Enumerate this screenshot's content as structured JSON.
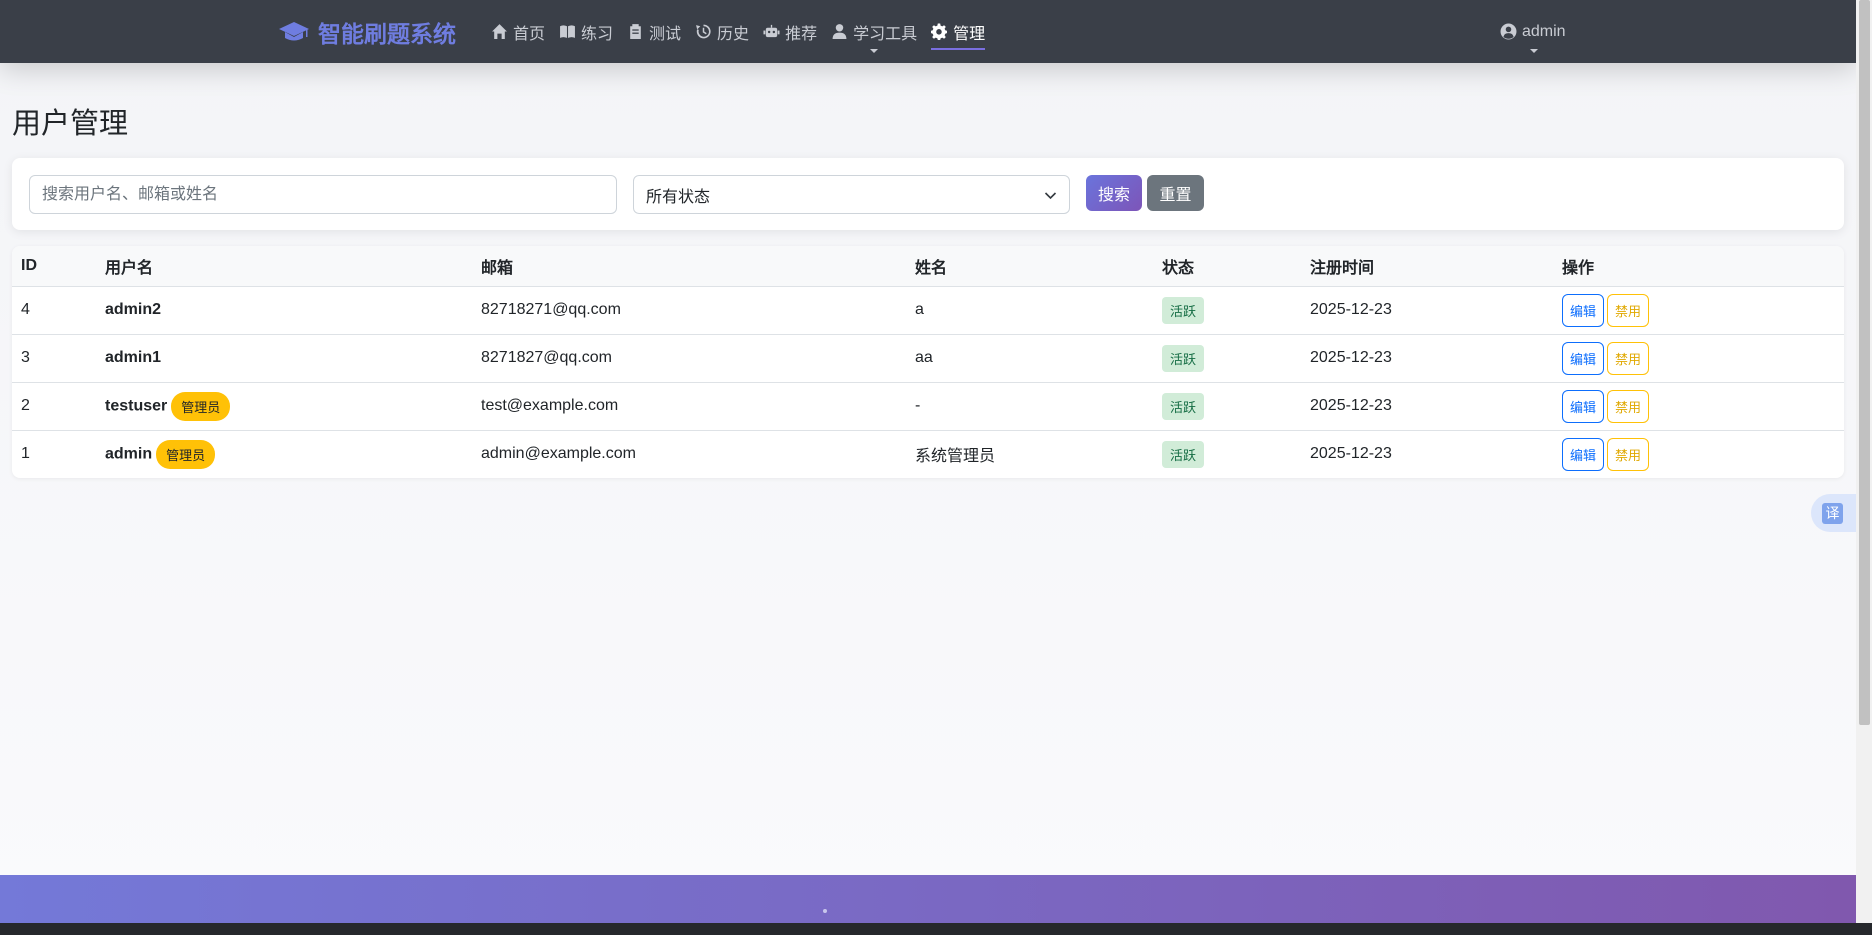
{
  "navbar": {
    "brand": "智能刷题系统",
    "items": [
      {
        "label": "首页",
        "icon": "home-icon"
      },
      {
        "label": "练习",
        "icon": "book-icon"
      },
      {
        "label": "测试",
        "icon": "clipboard-icon"
      },
      {
        "label": "历史",
        "icon": "history-icon"
      },
      {
        "label": "推荐",
        "icon": "robot-icon"
      },
      {
        "label": "学习工具",
        "icon": "user-icon"
      },
      {
        "label": "管理",
        "icon": "gear-icon"
      }
    ],
    "active_item": "管理",
    "user": "admin"
  },
  "page": {
    "title": "用户管理"
  },
  "filters": {
    "search_placeholder": "搜索用户名、邮箱或姓名",
    "search_value": "",
    "status_selected": "所有状态",
    "search_button": "搜索",
    "reset_button": "重置"
  },
  "table": {
    "columns": [
      "ID",
      "用户名",
      "邮箱",
      "姓名",
      "状态",
      "注册时间",
      "操作"
    ],
    "rows": [
      {
        "id": "4",
        "username": "admin2",
        "admin_badge": "",
        "email": "82718271@qq.com",
        "name": "a",
        "status": "活跃",
        "registered": "2025-12-23",
        "edit": "编辑",
        "disable": "禁用"
      },
      {
        "id": "3",
        "username": "admin1",
        "admin_badge": "",
        "email": "8271827@qq.com",
        "name": "aa",
        "status": "活跃",
        "registered": "2025-12-23",
        "edit": "编辑",
        "disable": "禁用"
      },
      {
        "id": "2",
        "username": "testuser",
        "admin_badge": "管理员",
        "email": "test@example.com",
        "name": "-",
        "status": "活跃",
        "registered": "2025-12-23",
        "edit": "编辑",
        "disable": "禁用"
      },
      {
        "id": "1",
        "username": "admin",
        "admin_badge": "管理员",
        "email": "admin@example.com",
        "name": "系统管理员",
        "status": "活跃",
        "registered": "2025-12-23",
        "edit": "编辑",
        "disable": "禁用"
      }
    ]
  },
  "translate": {
    "label": "译"
  },
  "colors": {
    "navbar_bg": "#3a3f48",
    "brand": "#6f7de0",
    "primary_gradient_start": "#6a74dc",
    "primary_gradient_end": "#7d55b8",
    "admin_badge": "#ffc107",
    "status_active_bg": "#d1ecd8"
  }
}
